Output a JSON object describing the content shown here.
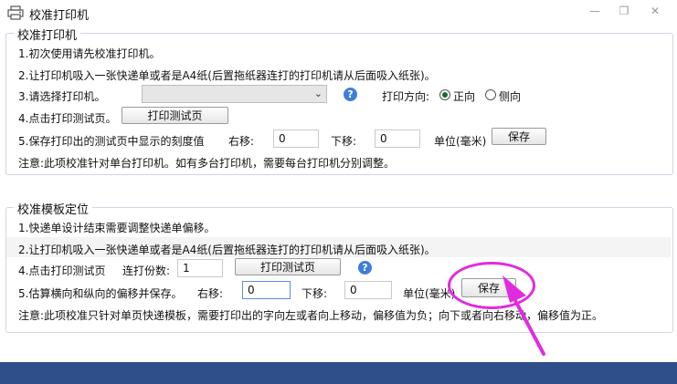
{
  "window": {
    "title": "校准打印机",
    "minimize_icon": "minimize-icon",
    "maximize_icon": "maximize-icon",
    "close_icon": "close-icon"
  },
  "section1": {
    "legend": "校准打印机",
    "line1": "1.初次使用请先校准打印机。",
    "line2": "2.让打印机吸入一张快递单或者是A4纸(后置拖纸器连打的打印机请从后面吸入纸张)。",
    "line3_label": "3.请选择打印机。",
    "printer_select_value": "",
    "direction_label": "打印方向:",
    "radio_portrait": "正向",
    "radio_landscape": "侧向",
    "line4_label": "4.点击打印测试页。",
    "print_test_button": "打印测试页",
    "line5_label": "5.保存打印出的测试页中显示的刻度值",
    "right_label": "右移:",
    "right_value": "0",
    "down_label": "下移:",
    "down_value": "0",
    "unit_label": "单位(毫米)",
    "save_button": "保存",
    "note": "注意:此项校准针对单台打印机。如有多台打印机，需要每台打印机分别调整。"
  },
  "section2": {
    "legend": "校准模板定位",
    "line1": "1.快递单设计结束需要调整快递单偏移。",
    "line2": "2.让打印机吸入一张快递单或者是A4纸(后置拖纸器连打的打印机请从后面吸入纸张)。",
    "line4_label": "4.点击打印测试页",
    "copies_label": "连打份数:",
    "copies_value": "1",
    "print_test_button": "打印测试页",
    "line5_label": "5.估算横向和纵向的偏移并保存。",
    "right_label": "右移:",
    "right_value": "0",
    "down_label": "下移:",
    "down_value": "0",
    "unit_label": "单位(毫米)",
    "save_button": "保存",
    "note": "注意:此项校准只针对单页快递模板，需要打印出的字向左或者向上移动，偏移值为负；向下或者向右移动，偏移值为正。"
  },
  "colors": {
    "highlight": "#e22be0",
    "statusbar": "#2f4f8a",
    "help_icon": "#3d7ed8"
  }
}
